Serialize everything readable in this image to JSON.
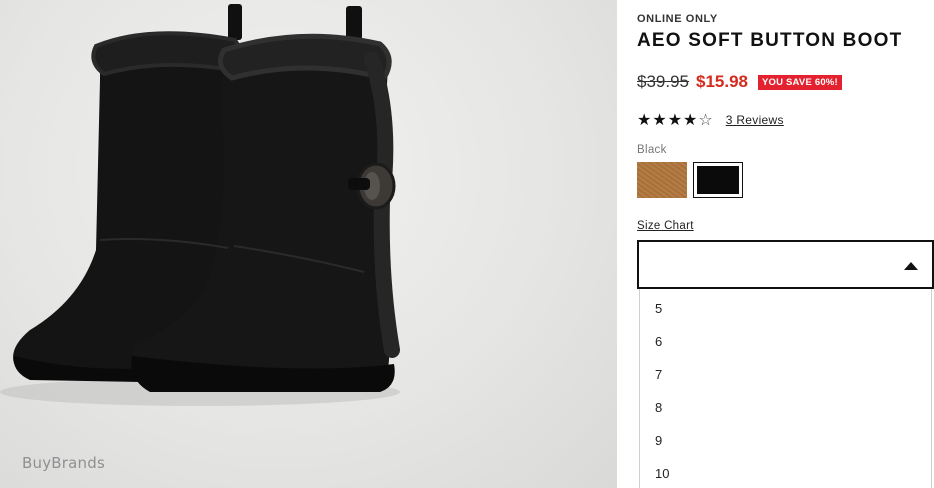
{
  "product_image": {
    "alt": "Black suede boot pair with faux fur trim and wooden toggle button",
    "watermark": "BuyBrands"
  },
  "product": {
    "eyebrow": "ONLINE ONLY",
    "title": "AEO SOFT BUTTON BOOT",
    "original_price": "$39.95",
    "sale_price": "$15.98",
    "save_badge": "YOU SAVE 60%!",
    "rating": 4,
    "rating_max": 5,
    "reviews_link": "3 Reviews"
  },
  "color": {
    "selected_label": "Black",
    "swatches": [
      {
        "name": "cognac",
        "hex": "#a56f3c",
        "selected": false
      },
      {
        "name": "black",
        "hex": "#0b0b0b",
        "selected": true
      }
    ]
  },
  "size": {
    "size_chart_link": "Size Chart",
    "selected": "",
    "expanded": true,
    "options": [
      "5",
      "6",
      "7",
      "8",
      "9",
      "10"
    ]
  },
  "colors": {
    "sale": "#d52b1e",
    "badge": "#e4212f",
    "text": "#222222"
  }
}
